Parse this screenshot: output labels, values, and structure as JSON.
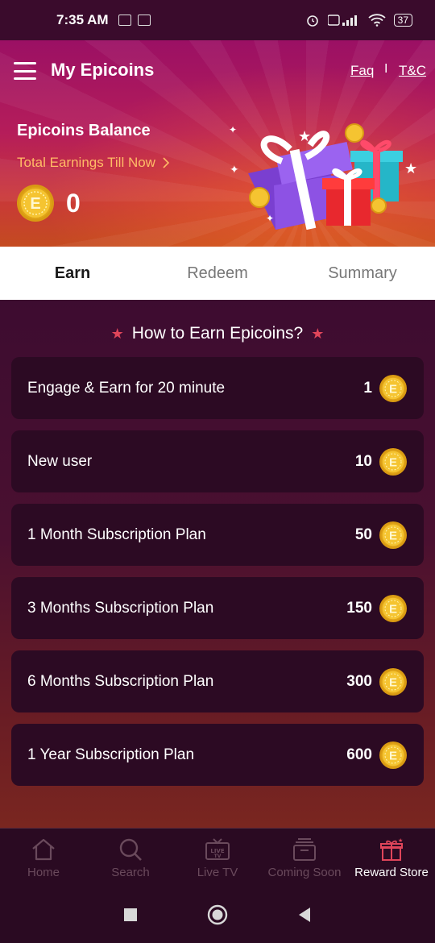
{
  "status_bar": {
    "time": "7:35 AM",
    "battery": "37"
  },
  "header": {
    "title": "My Epicoins",
    "faq_label": "Faq",
    "separator": "I",
    "tc_label": "T&C",
    "balance_title": "Epicoins Balance",
    "earnings_link": "Total Earnings Till Now",
    "balance_value": "0"
  },
  "tabs": [
    {
      "label": "Earn",
      "active": true
    },
    {
      "label": "Redeem",
      "active": false
    },
    {
      "label": "Summary",
      "active": false
    }
  ],
  "section": {
    "title": "How to Earn Epicoins?"
  },
  "earn_items": [
    {
      "label": "Engage & Earn for 20 minute",
      "points": "1"
    },
    {
      "label": "New user",
      "points": "10"
    },
    {
      "label": "1 Month Subscription Plan",
      "points": "50"
    },
    {
      "label": "3 Months Subscription Plan",
      "points": "150"
    },
    {
      "label": "6 Months Subscription Plan",
      "points": "300"
    },
    {
      "label": "1 Year Subscription Plan",
      "points": "600"
    }
  ],
  "bottom_nav": [
    {
      "label": "Home",
      "icon": "home-icon"
    },
    {
      "label": "Search",
      "icon": "search-icon"
    },
    {
      "label": "Live TV",
      "icon": "live-tv-icon"
    },
    {
      "label": "Coming Soon",
      "icon": "coming-soon-icon"
    },
    {
      "label": "Reward Store",
      "icon": "reward-store-icon",
      "active": true
    }
  ],
  "colors": {
    "accent_orange": "#ffbb66",
    "star_red": "#e0455a",
    "coin_gold": "#f2b524",
    "card_bg": "#2c0a23",
    "active_nav": "#e0455a"
  }
}
